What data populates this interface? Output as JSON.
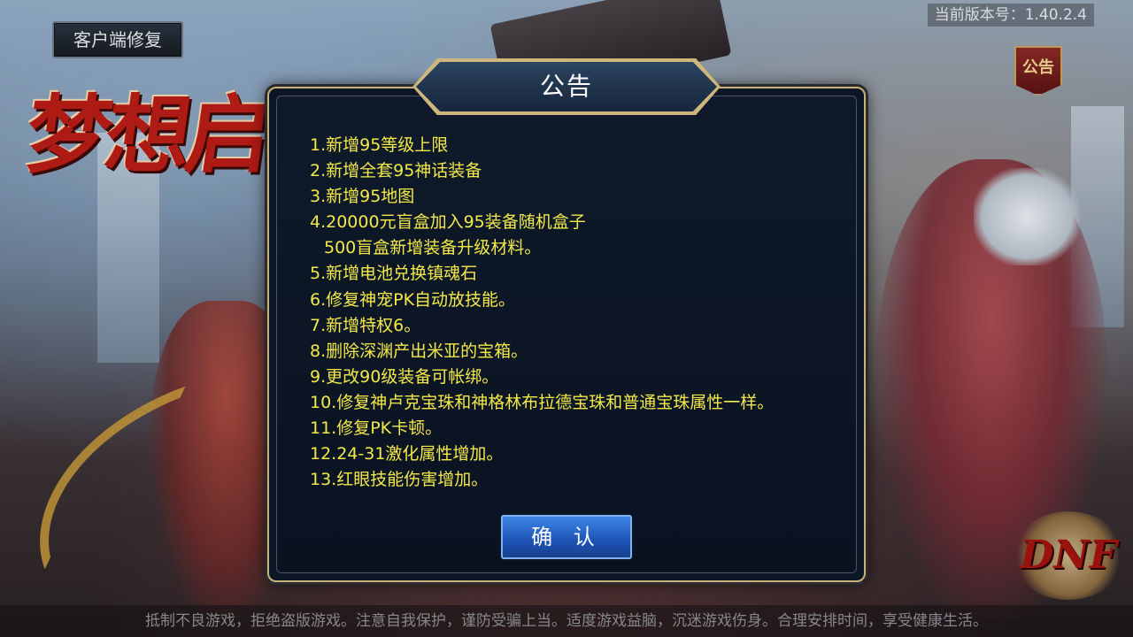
{
  "top_left": {
    "repair_label": "客户端修复"
  },
  "version": {
    "text": "当前版本号：1.40.2.4"
  },
  "game_title": {
    "text": "梦想启"
  },
  "notice_badge": {
    "label": "公告"
  },
  "dialog": {
    "title": "公告",
    "lines": [
      "1.新增95等级上限",
      "2.新增全套95神话装备",
      "3.新增95地图",
      "4.20000元盲盒加入95装备随机盒子",
      "500盲盒新增装备升级材料。",
      "5.新增电池兑换镇魂石",
      "6.修复神宠PK自动放技能。",
      "7.新增特权6。",
      "8.删除深渊产出米亚的宝箱。",
      "9.更改90级装备可帐绑。",
      "10.修复神卢克宝珠和神格林布拉德宝珠和普通宝珠属性一样。",
      "11.修复PK卡顿。",
      "12.24-31激化属性增加。",
      "13.红眼技能伤害增加。"
    ],
    "confirm_label": "确 认"
  },
  "logo": {
    "text": "DNF"
  },
  "footer": {
    "health_tip": "抵制不良游戏，拒绝盗版游戏。注意自我保护，谨防受骗上当。适度游戏益脑，沉迷游戏伤身。合理安排时间，享受健康生活。"
  },
  "colors": {
    "notice_text": "#f3e94a",
    "confirm_button": "#2a66c8",
    "frame_gold": "#c9b27a"
  }
}
